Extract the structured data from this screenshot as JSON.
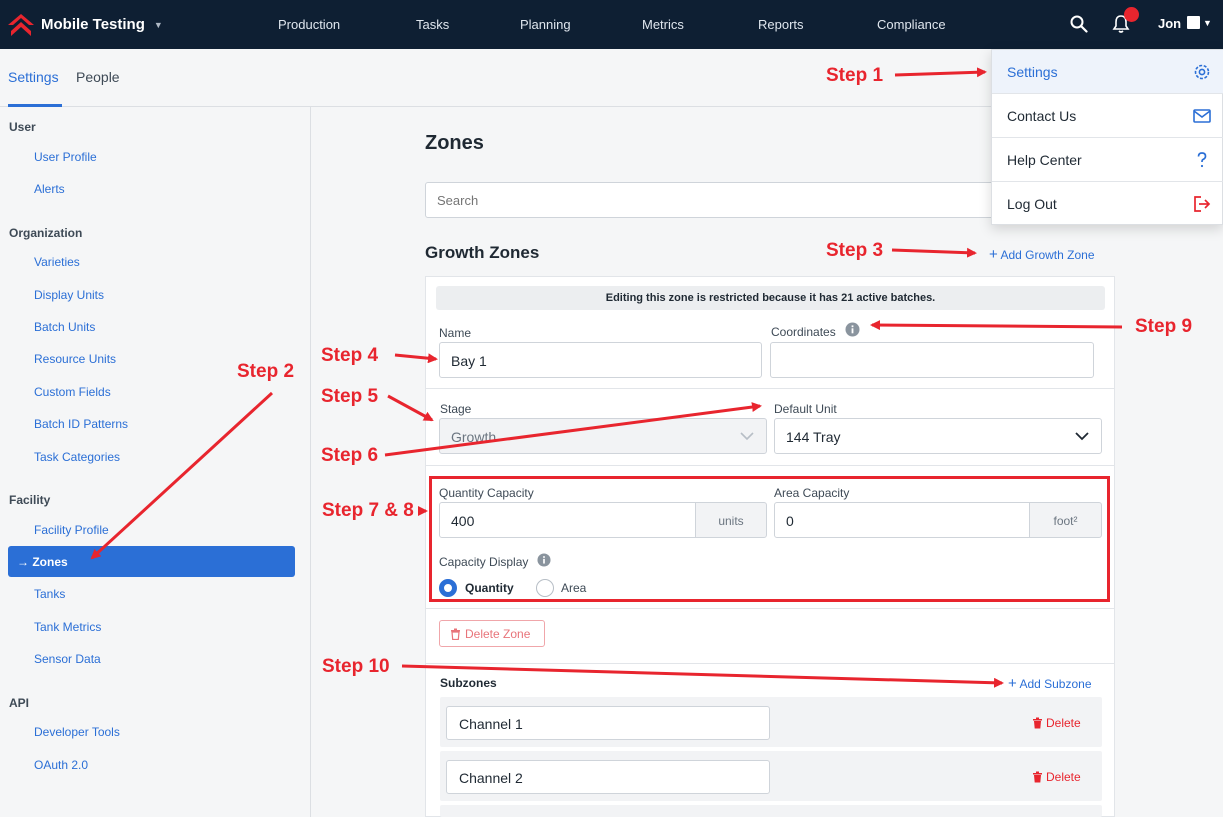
{
  "app": {
    "title": "Mobile Testing",
    "nav": [
      "Production",
      "Tasks",
      "Planning",
      "Metrics",
      "Reports",
      "Compliance"
    ],
    "user": "Jon",
    "icons": [
      "logo-icon",
      "search-icon",
      "bell-icon",
      "chevron-down-icon"
    ]
  },
  "tabs": [
    "Settings",
    "People"
  ],
  "sidebar": {
    "sections": [
      {
        "label": "User",
        "items": [
          "User Profile",
          "Alerts"
        ]
      },
      {
        "label": "Organization",
        "items": [
          "Varieties",
          "Display Units",
          "Batch Units",
          "Resource Units",
          "Custom Fields",
          "Batch ID Patterns",
          "Task Categories"
        ]
      },
      {
        "label": "Facility",
        "items": [
          "Facility Profile",
          "→ Zones",
          "Tanks",
          "Tank Metrics",
          "Sensor Data"
        ]
      },
      {
        "label": "API",
        "items": [
          "Developer Tools",
          "OAuth 2.0"
        ]
      }
    ],
    "active": "→ Zones"
  },
  "main": {
    "title": "Zones",
    "search_placeholder": "Search",
    "growth_title": "Growth Zones",
    "add_growth_zone": "Add Growth Zone",
    "restriction_notice": "Editing this zone is restricted because it has 21 active batches.",
    "name_label": "Name",
    "name_value": "Bay 1",
    "coordinates_label": "Coordinates",
    "coordinates_value": "",
    "stage_label": "Stage",
    "stage_value": "Growth",
    "default_unit_label": "Default Unit",
    "default_unit_value": "144 Tray",
    "quantity_capacity_label": "Quantity Capacity",
    "quantity_capacity_value": "400",
    "quantity_unit": "units",
    "area_capacity_label": "Area Capacity",
    "area_capacity_value": "0",
    "area_unit": "foot²",
    "capacity_display_label": "Capacity Display",
    "capacity_options": [
      "Quantity",
      "Area"
    ],
    "capacity_selected": "Quantity",
    "delete_zone": "Delete Zone",
    "subzones_title": "Subzones",
    "add_subzone": "Add Subzone",
    "subzones": [
      {
        "name": "Channel 1",
        "delete": "Delete"
      },
      {
        "name": "Channel 2",
        "delete": "Delete"
      }
    ]
  },
  "dropdown": {
    "items": [
      {
        "label": "Settings",
        "icon": "gear-icon"
      },
      {
        "label": "Contact Us",
        "icon": "mail-icon"
      },
      {
        "label": "Help Center",
        "icon": "question-icon"
      },
      {
        "label": "Log Out",
        "icon": "logout-icon"
      }
    ]
  },
  "annotations": [
    "Step 1",
    "Step 2",
    "Step 3",
    "Step 4",
    "Step 5",
    "Step 6",
    "Step 7 & 8",
    "Step 9",
    "Step 10"
  ],
  "colors": {
    "nav_bg": "#0e1f33",
    "accent": "#2b6fd6",
    "annotation": "#e8252e",
    "notification": "#e8252e"
  }
}
